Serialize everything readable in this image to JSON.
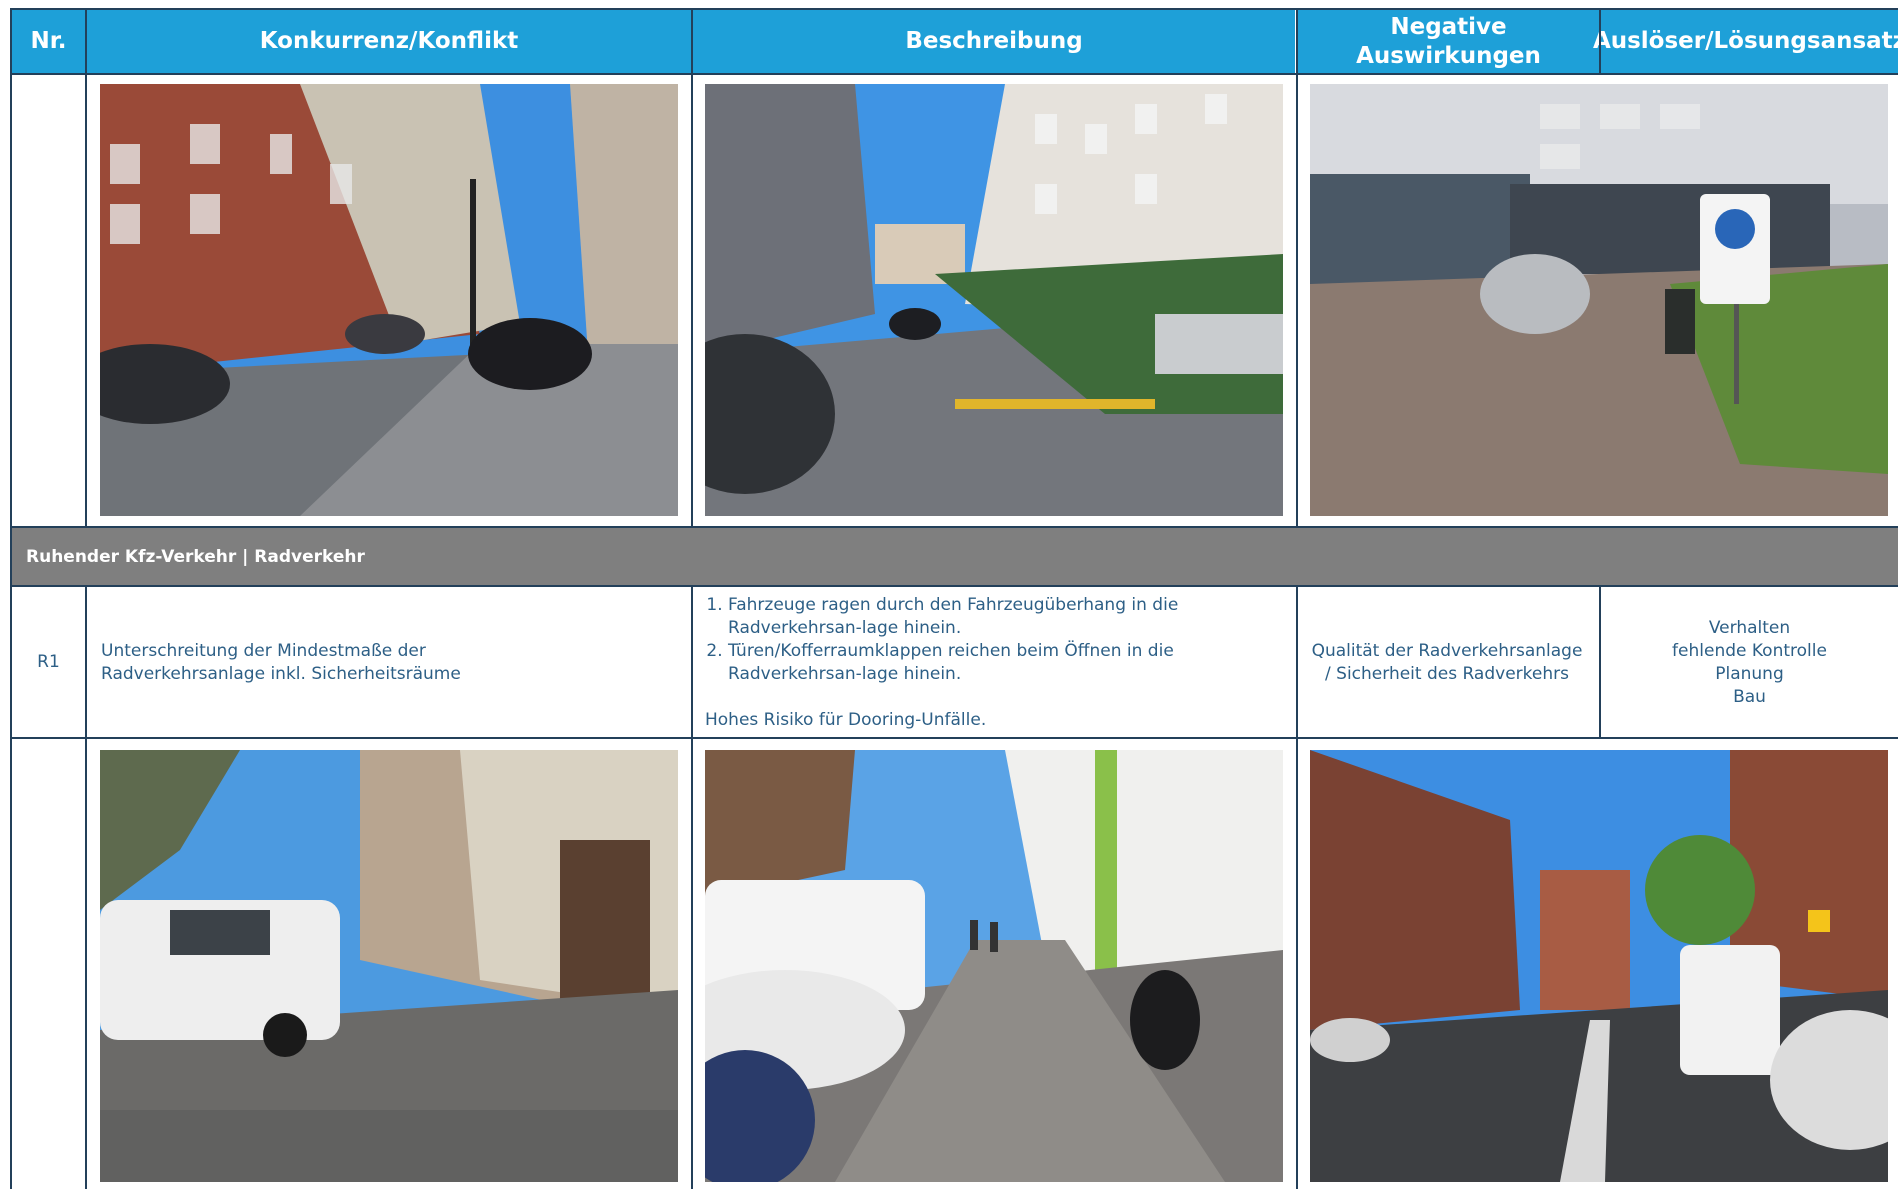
{
  "header": {
    "nr": "Nr.",
    "konflikt": "Konkurrenz/Konflikt",
    "beschreibung": "Beschreibung",
    "negative": "Negative Auswirkungen",
    "ausloeser": "Auslöser/Lösungsansatz"
  },
  "section": {
    "title": "Ruhender Kfz-Verkehr | Radverkehr"
  },
  "row_r1": {
    "nr": "R1",
    "konflikt": "Unterschreitung der Mindestmaße der Radverkehrsanlage inkl. Sicherheitsräume",
    "beschreibung_items": [
      "Fahrzeuge ragen durch den Fahrzeugüberhang in die Radverkehrsan-lage hinein.",
      "Türen/Kofferraumklappen reichen beim Öffnen in die Radverkehrsan-lage hinein."
    ],
    "beschreibung_note": "Hohes Risiko für Dooring-Unfälle.",
    "negative": "Qualität der Radverkehrsanlage / Sicherheit des Radverkehrs",
    "ausloeser_lines": [
      "Verhalten",
      "fehlende Kontrolle",
      "Planung",
      "Bau"
    ]
  },
  "photos": {
    "top": [
      {
        "name": "street-photo-brick-buildings"
      },
      {
        "name": "street-photo-modern-buildings"
      },
      {
        "name": "street-photo-zone-sign"
      }
    ],
    "bottom": [
      {
        "name": "street-photo-parked-van"
      },
      {
        "name": "street-photo-sidewalk-scooter"
      },
      {
        "name": "street-photo-bike-lane-van"
      }
    ]
  },
  "colors": {
    "header_bg": "#1ea0d8",
    "section_bg": "#7f7f7f",
    "text": "#2d5f86",
    "grid": "#23405a"
  }
}
